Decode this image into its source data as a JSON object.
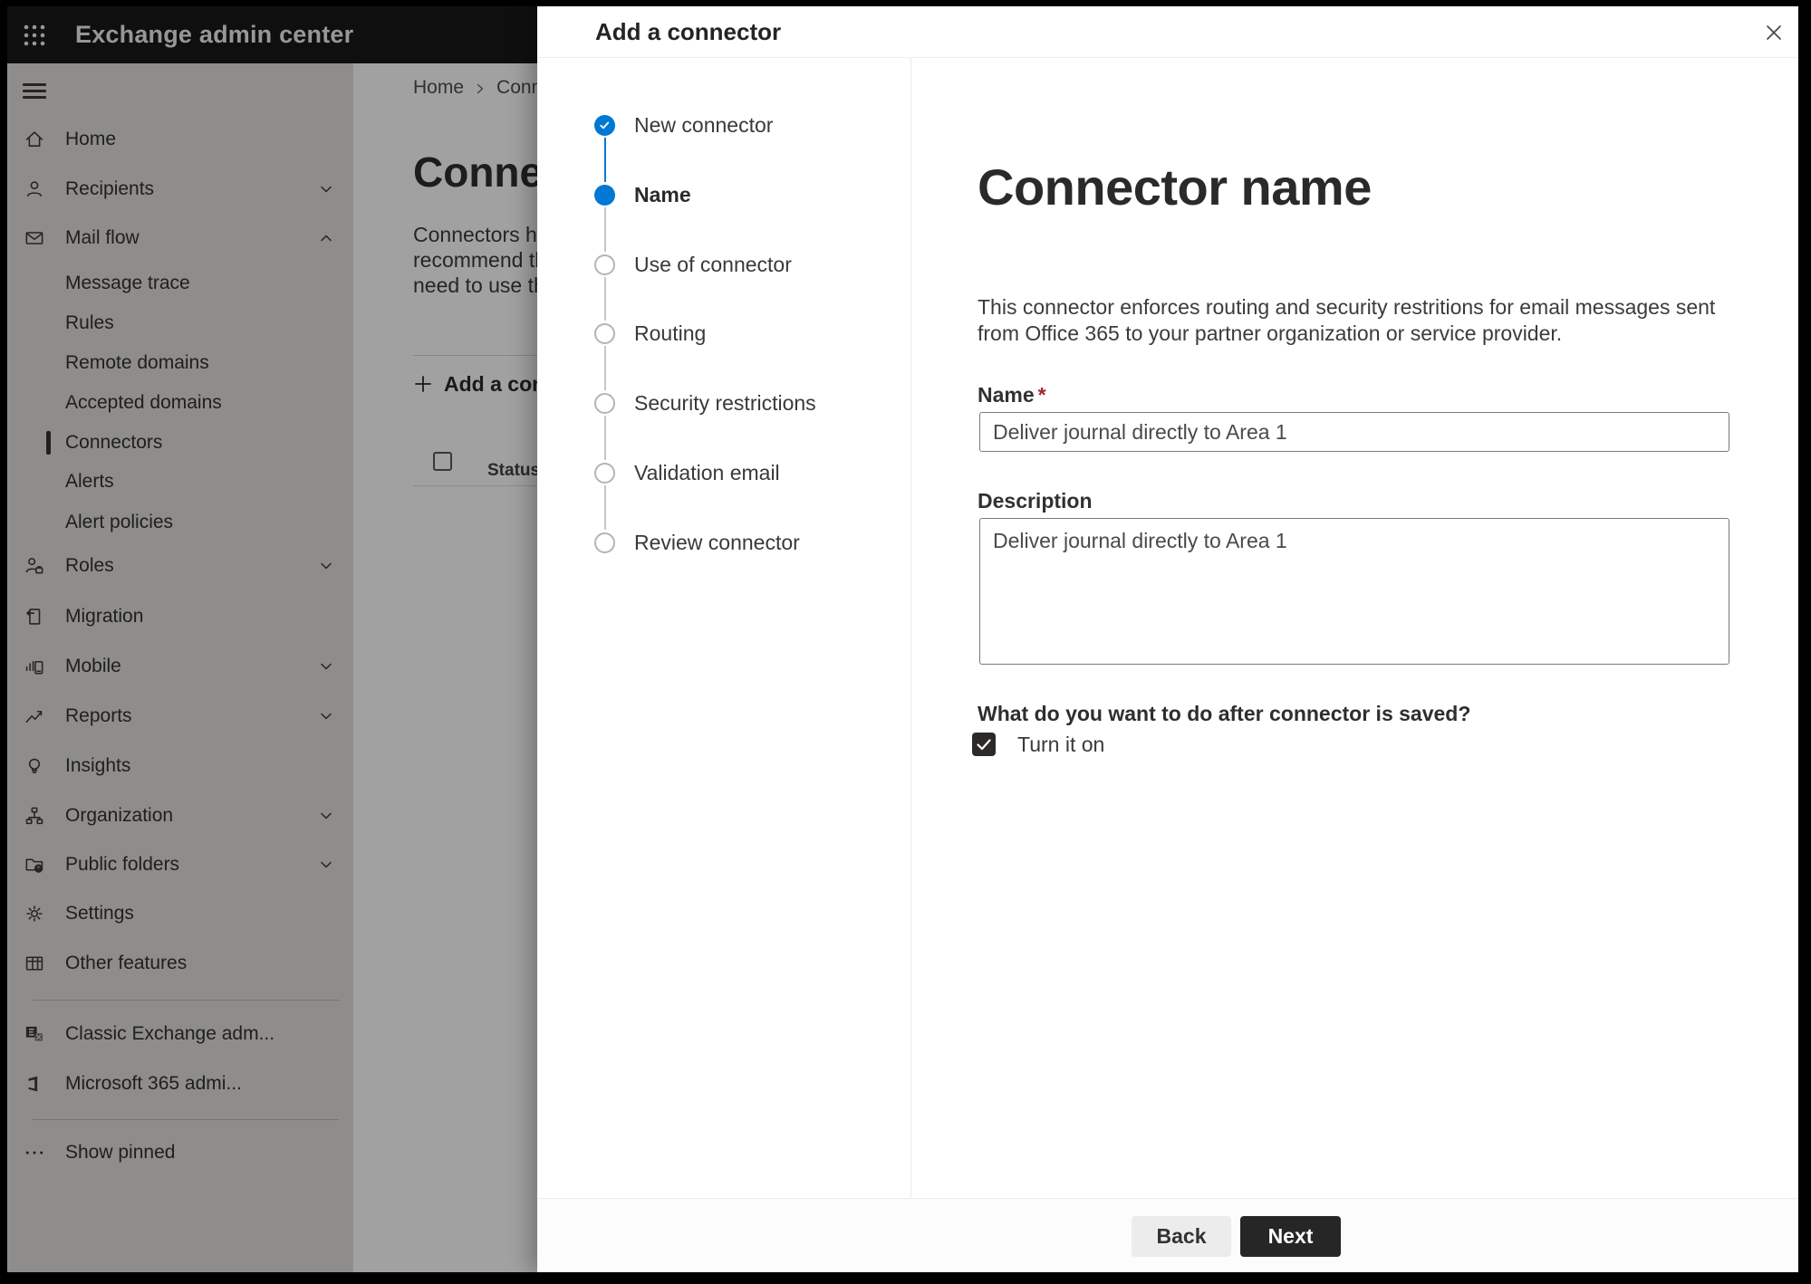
{
  "top_bar": {
    "title": "Exchange admin center"
  },
  "sidebar": {
    "items": [
      {
        "icon": "home",
        "label": "Home"
      },
      {
        "icon": "person",
        "label": "Recipients",
        "chevron": "down"
      },
      {
        "icon": "mail",
        "label": "Mail flow",
        "chevron": "up"
      },
      {
        "label": "Message trace",
        "sub": true
      },
      {
        "label": "Rules",
        "sub": true
      },
      {
        "label": "Remote domains",
        "sub": true
      },
      {
        "label": "Accepted domains",
        "sub": true
      },
      {
        "label": "Connectors",
        "sub": true,
        "selected": true
      },
      {
        "label": "Alerts",
        "sub": true
      },
      {
        "label": "Alert policies",
        "sub": true
      },
      {
        "icon": "person-briefcase",
        "label": "Roles",
        "chevron": "down"
      },
      {
        "icon": "migration",
        "label": "Migration"
      },
      {
        "icon": "mobile",
        "label": "Mobile",
        "chevron": "down"
      },
      {
        "icon": "reports",
        "label": "Reports",
        "chevron": "down"
      },
      {
        "icon": "insights",
        "label": "Insights"
      },
      {
        "icon": "organization",
        "label": "Organization",
        "chevron": "down"
      },
      {
        "icon": "public-folders",
        "label": "Public folders",
        "chevron": "down"
      },
      {
        "icon": "settings",
        "label": "Settings"
      },
      {
        "icon": "other-features",
        "label": "Other features"
      },
      {
        "divider": true
      },
      {
        "icon": "exchange-logo",
        "label": "Classic Exchange adm..."
      },
      {
        "icon": "office-logo",
        "label": "Microsoft 365 admi..."
      },
      {
        "divider": true
      },
      {
        "icon": "ellipsis",
        "label": "Show pinned"
      }
    ]
  },
  "background_page": {
    "breadcrumb_home": "Home",
    "breadcrumb_current": "Conne",
    "title": "Connect",
    "paragraph_lines": [
      "Connectors help",
      "recommend that",
      "need to use ther"
    ],
    "add_button_label": "Add a conn",
    "status_header": "Status"
  },
  "dialog": {
    "title": "Add a connector",
    "steps": [
      {
        "label": "New connector",
        "state": "completed"
      },
      {
        "label": "Name",
        "state": "current"
      },
      {
        "label": "Use of connector",
        "state": "upcoming"
      },
      {
        "label": "Routing",
        "state": "upcoming"
      },
      {
        "label": "Security restrictions",
        "state": "upcoming"
      },
      {
        "label": "Validation email",
        "state": "upcoming"
      },
      {
        "label": "Review connector",
        "state": "upcoming"
      }
    ],
    "content": {
      "heading": "Connector name",
      "description": "This connector enforces routing and security restritions for email messages sent from Office 365 to your partner organization or service provider.",
      "name_label": "Name",
      "required_marker": "*",
      "name_value": "Deliver journal directly to Area 1",
      "description_label": "Description",
      "description_value": "Deliver journal directly to Area 1",
      "after_save_question": "What do you want to do after connector is saved?",
      "turn_on_label": "Turn it on",
      "turn_on_checked": true
    },
    "footer": {
      "back_label": "Back",
      "next_label": "Next"
    }
  },
  "colors": {
    "accent": "#0078d4",
    "primary_button": "#262626",
    "required": "#a4262c",
    "top_bar_bg": "#191919",
    "sidebar_bg": "#e1dfdd"
  }
}
